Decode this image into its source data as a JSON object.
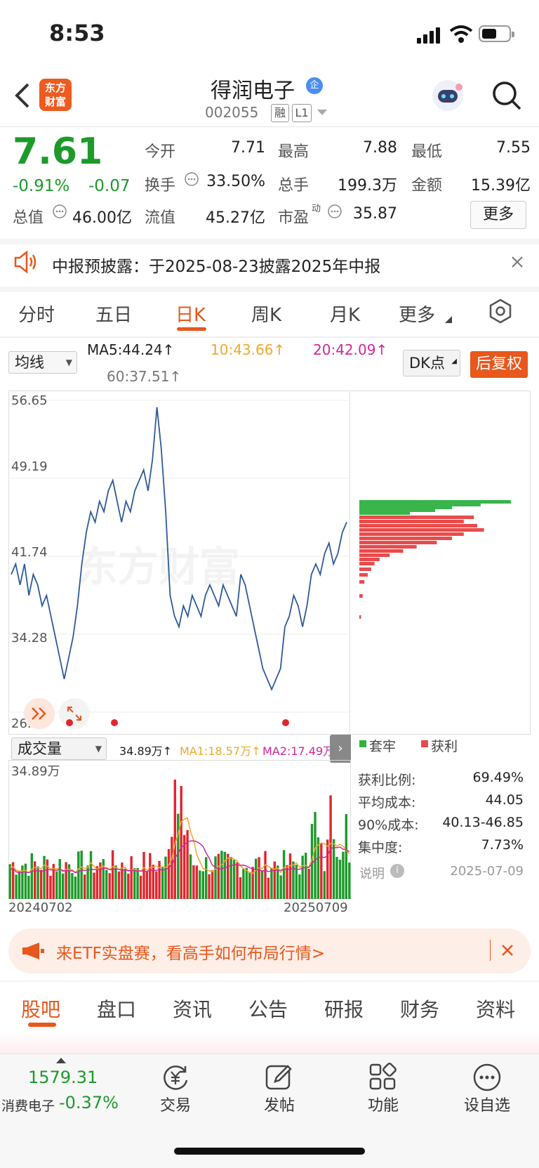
{
  "status": {
    "time": "8:53"
  },
  "header": {
    "logo_line1": "东方",
    "logo_line2": "财富",
    "title": "得润电子",
    "verified_badge": "企",
    "code": "002055",
    "tag1": "融",
    "tag2": "L1"
  },
  "quote": {
    "price": "7.61",
    "pct": "-0.91%",
    "chg": "-0.07",
    "rows": [
      [
        {
          "label": "今开",
          "value": "7.71",
          "color": "red"
        },
        {
          "label": "最高",
          "value": "7.88",
          "color": "red"
        },
        {
          "label": "最低",
          "value": "7.55",
          "color": "green"
        }
      ],
      [
        {
          "label": "换手",
          "value": "33.50%",
          "color": "black"
        },
        {
          "label": "总手",
          "value": "199.3万",
          "color": "black"
        },
        {
          "label": "金额",
          "value": "15.39亿",
          "color": "black"
        }
      ],
      [
        {
          "label": "总值",
          "value": "46.00亿",
          "color": "black"
        },
        {
          "label": "流值",
          "value": "45.27亿",
          "color": "black"
        },
        {
          "label": "市盈",
          "value": "35.87",
          "color": "black"
        }
      ]
    ],
    "pe_sup": "动",
    "more": "更多"
  },
  "notice": {
    "text": "中报预披露：于2025-08-23披露2025年中报"
  },
  "tabs": [
    "分时",
    "五日",
    "日K",
    "周K",
    "月K",
    "更多"
  ],
  "active_tab": 2,
  "chart_controls": {
    "ma_select": "均线",
    "ma5": "MA5:44.24↑",
    "ma10": "10:43.66↑",
    "ma20": "20:42.09↑",
    "ma60": "60:37.51↑",
    "dk": "DK点",
    "adjust": "后复权"
  },
  "chart_data": {
    "type": "line",
    "yticks": [
      "56.65",
      "49.19",
      "41.74",
      "34.28",
      "26.83"
    ],
    "ylim": [
      26.83,
      56.65
    ],
    "x_start": "20240702",
    "x_end": "20250709",
    "price": [
      40,
      41,
      39,
      41,
      38,
      40,
      39,
      37,
      38,
      36,
      34,
      32,
      30,
      32,
      34,
      37,
      41,
      44,
      46,
      45,
      47,
      46,
      48,
      49,
      47,
      45,
      47,
      46,
      48,
      49,
      50,
      48,
      51,
      56,
      52,
      46,
      38,
      36,
      35,
      37,
      36,
      38,
      37,
      36,
      38,
      39,
      38,
      37,
      39,
      38,
      37,
      36,
      40,
      39,
      37,
      35,
      33,
      31,
      30,
      29,
      30,
      31,
      35,
      36,
      38,
      37,
      35,
      37,
      40,
      41,
      40,
      42,
      43,
      41,
      42,
      44,
      45
    ],
    "watermark": "东方财富",
    "signal_dots": 3
  },
  "chip": {
    "legend_trapped": "套牢",
    "legend_profit": "获利",
    "stats": [
      {
        "label": "获利比例:",
        "value": "69.49%"
      },
      {
        "label": "平均成本:",
        "value": "44.05"
      },
      {
        "label": "90%成本:",
        "value": "40.13-46.85"
      },
      {
        "label": "集中度:",
        "value": "7.73%"
      }
    ],
    "note": "说明",
    "date": "2025-07-09"
  },
  "volume": {
    "select": "成交量",
    "vol": "34.89万↑",
    "ma1": "MA1:18.57万↑",
    "ma2": "MA2:17.49万↑",
    "ymax": "34.89万"
  },
  "ad": {
    "text": "来ETF实盘赛，看高手如何布局行情>"
  },
  "bottom_tabs": [
    "股吧",
    "盘口",
    "资讯",
    "公告",
    "研报",
    "财务",
    "资料"
  ],
  "dock": {
    "index_value": "1579.31",
    "index_name": "消费电子",
    "index_pct": "-0.37%",
    "items": [
      "交易",
      "发帖",
      "功能",
      "设自选"
    ]
  },
  "colors": {
    "accent": "#e8571b",
    "up": "#e0262e",
    "down": "#1d9a2a",
    "line": "#2d5a9a"
  }
}
